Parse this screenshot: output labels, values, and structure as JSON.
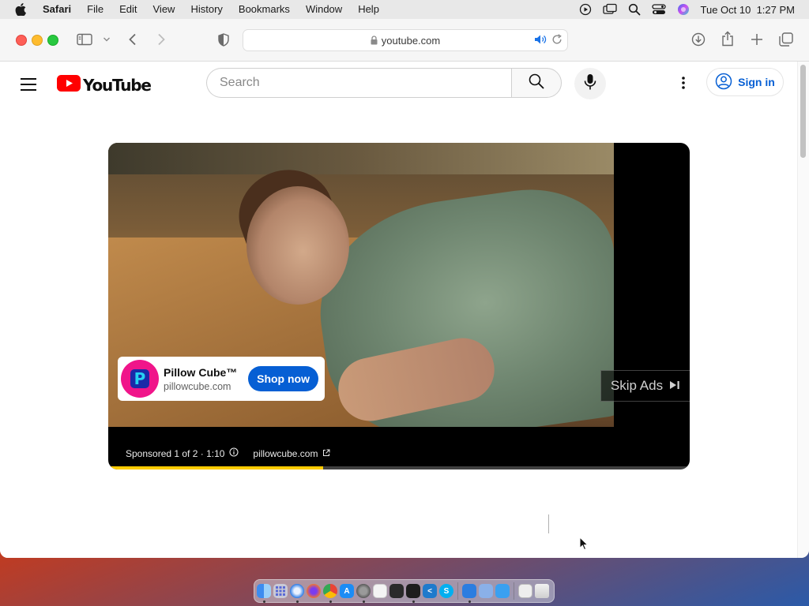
{
  "menubar": {
    "app_name": "Safari",
    "items": [
      "File",
      "Edit",
      "View",
      "History",
      "Bookmarks",
      "Window",
      "Help"
    ],
    "datetime": "Tue Oct 10  1:27 PM",
    "status_icons": [
      "screen-record-icon",
      "screen-mirror-icon",
      "spotlight-search-icon",
      "control-center-icon",
      "siri-icon"
    ]
  },
  "browser": {
    "address_text": "youtube.com",
    "toolbar_icons": [
      "sidebar-icon",
      "chevron-down-icon",
      "back-arrow-icon",
      "forward-arrow-icon",
      "shield-icon",
      "lock-icon",
      "speaker-icon",
      "reload-icon",
      "download-icon",
      "share-icon",
      "new-tab-icon",
      "tab-overview-icon"
    ]
  },
  "youtube": {
    "logo_text": "YouTube",
    "search_placeholder": "Search",
    "signin_label": "Sign in",
    "brand_red": "#ff0000",
    "link_blue": "#065fd4"
  },
  "ad": {
    "advertiser": "Pillow Cube™",
    "advertiser_url": "pillowcube.com",
    "cta_label": "Shop now",
    "logo_letter": "P",
    "skip_label": "Skip Ads",
    "sponsored_text": "Sponsored 1 of 2 · 1:10",
    "info_link": "pillowcube.com",
    "progress": 0.37,
    "progress_color": "#ffcc00"
  },
  "dock": {
    "apps": [
      "Finder",
      "Launchpad",
      "Safari",
      "Firefox",
      "Chrome",
      "App Store",
      "Settings",
      "TextEdit",
      "Pages",
      "Terminal",
      "VS Code",
      "Skype",
      "Xcode",
      "Remote Desktop",
      "Script Editor",
      "Preview",
      "Trash"
    ]
  }
}
